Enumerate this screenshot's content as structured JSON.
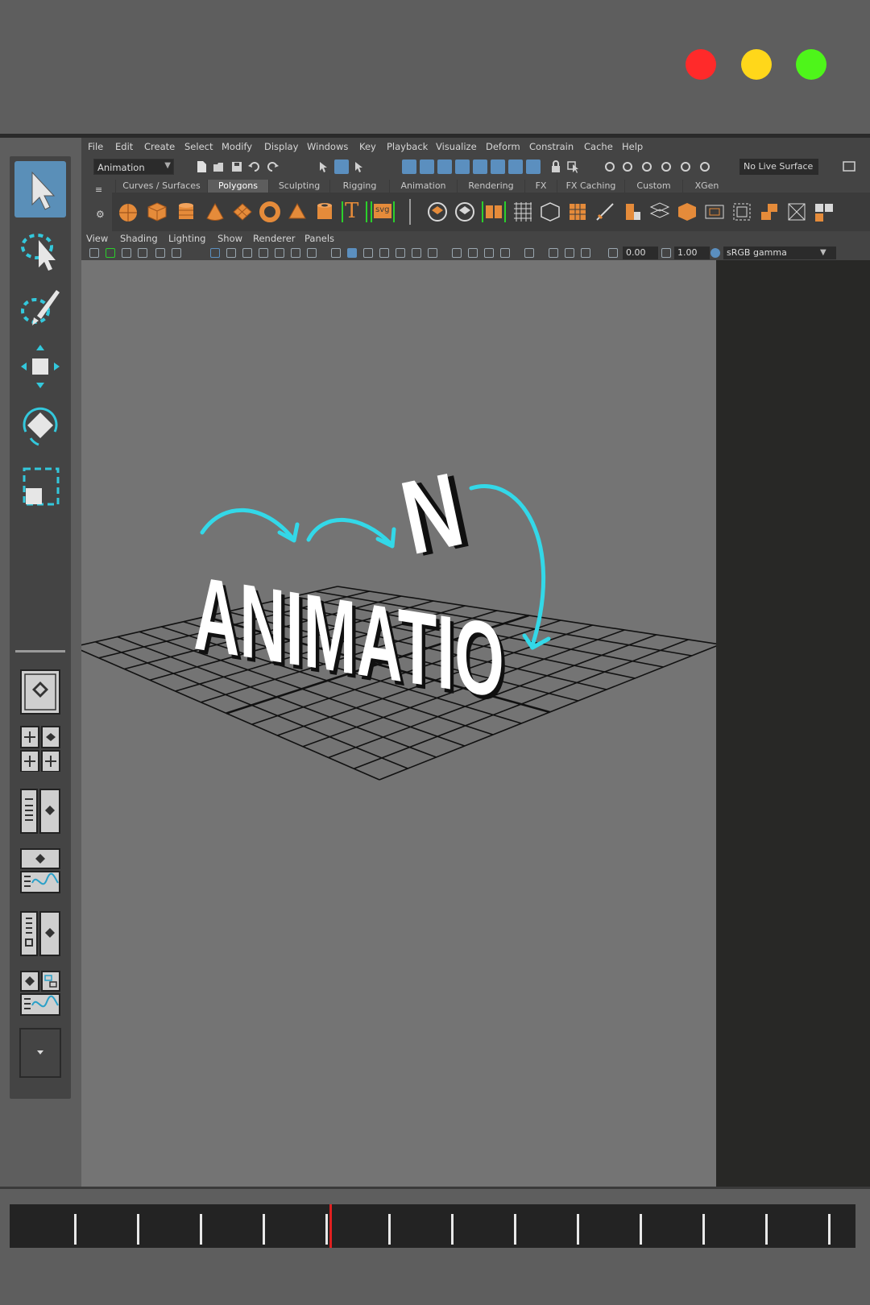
{
  "window": {
    "controls": [
      {
        "name": "close",
        "color": "#ff2a2a"
      },
      {
        "name": "minimize",
        "color": "#ffd71a"
      },
      {
        "name": "maximize",
        "color": "#4ef51a"
      }
    ]
  },
  "menubar": {
    "items": [
      "File",
      "Edit",
      "Create",
      "Select",
      "Modify",
      "Display",
      "Windows",
      "Key",
      "Playback",
      "Visualize",
      "Deform",
      "Constrain",
      "Cache",
      "Help"
    ]
  },
  "statusline": {
    "mode": "Animation",
    "live_surface": "No Live Surface"
  },
  "shelf": {
    "tabs": [
      "Curves / Surfaces",
      "Polygons",
      "Sculpting",
      "Rigging",
      "Animation",
      "Rendering",
      "FX",
      "FX Caching",
      "Custom",
      "XGen"
    ],
    "active_tab": "Polygons",
    "type_tool_label": "T",
    "svg_tool_label": "svg",
    "accent_color": "#e58b3a"
  },
  "panel": {
    "menus": [
      "View",
      "Shading",
      "Lighting",
      "Show",
      "Renderer",
      "Panels"
    ],
    "exposure": "0.00",
    "gamma": "1.00",
    "color_space": "sRGB gamma"
  },
  "viewport": {
    "text_main": "ANIMATIO",
    "text_letter": "N",
    "arrow_color": "#33d8e8",
    "grid": true
  },
  "toolbox": {
    "tools": [
      "select-tool",
      "lasso-tool",
      "paint-select-tool",
      "move-tool",
      "rotate-tool",
      "scale-tool"
    ],
    "active_tool": "select-tool"
  },
  "timeline": {
    "ticks": 13,
    "playhead_tick": 5,
    "playhead_color": "#e02020"
  }
}
